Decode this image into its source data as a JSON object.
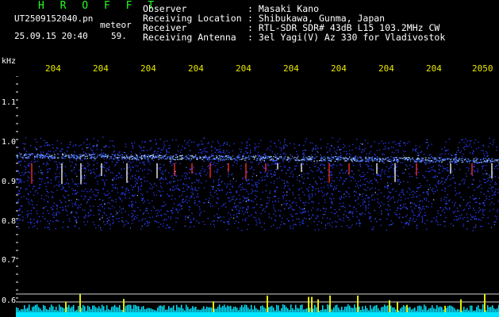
{
  "header": {
    "brand": "H R O F F T",
    "filename": "UT2509152040.pn",
    "app": "meteor",
    "timestamp": "25.09.15 20:40",
    "count": "59.",
    "meta": [
      {
        "key": "Observer",
        "value": ": Masaki Kano"
      },
      {
        "key": "Receiving Location",
        "value": ": Shibukawa, Gunma, Japan"
      },
      {
        "key": "Receiver",
        "value": ": RTL-SDR SDR# 43dB L15 103.2MHz CW"
      },
      {
        "key": "Receiving Antenna",
        "value": ": 3el Yagi(V) Az 330 for Vladivostok"
      }
    ]
  },
  "axis": {
    "unit": "kHz",
    "y_ticks": [
      "1.1",
      "1.0",
      "0.9",
      "0.8",
      "0.7",
      "0.6"
    ],
    "x_ticks": [
      "204",
      "204",
      "204",
      "204",
      "204",
      "204",
      "204",
      "204",
      "204",
      "2050"
    ]
  },
  "colors": {
    "brand": "#22ff22",
    "tick_label": "#e8e800",
    "signal": "#2a3cff",
    "bright": "#ffffff",
    "hot": "#ff3030",
    "baseline": "#00e5ff"
  }
}
